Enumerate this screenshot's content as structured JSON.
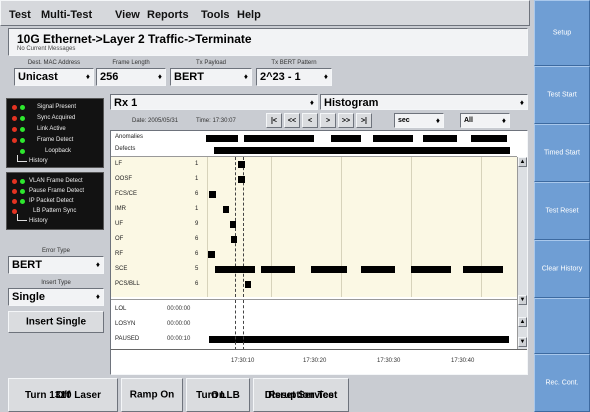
{
  "menu": [
    "Test",
    "Multi-Test",
    "View",
    "Reports",
    "Tools",
    "Help"
  ],
  "header": {
    "title": "10G Ethernet->Layer 2 Traffic->Terminate",
    "subtitle": "No Current Messages"
  },
  "selectors": [
    {
      "label": "Dest. MAC Address",
      "value": "Unicast"
    },
    {
      "label": "Frame Length",
      "value": "256"
    },
    {
      "label": "Tx Payload",
      "value": "BERT"
    },
    {
      "label": "Tx BERT Pattern",
      "value": "2^23 - 1"
    }
  ],
  "led_panel_1": {
    "items": [
      "Signal Present",
      "Sync Acquired",
      "Link Active",
      "Frame Detect",
      "Loopback"
    ],
    "history": "History"
  },
  "led_panel_2": {
    "items": [
      "VLAN Frame Detect",
      "Pause Frame Detect",
      "IP Packet Detect",
      "LB Pattern Sync"
    ],
    "history": "History"
  },
  "error_type": {
    "label": "Error Type",
    "value": "BERT"
  },
  "insert_type": {
    "label": "Insert Type",
    "value": "Single"
  },
  "insert_button": "Insert Single",
  "view": {
    "port": "Rx 1",
    "mode": "Histogram",
    "date_label": "Date: 2005/05/31",
    "time_label": "Time: 17:30:07",
    "nav": [
      "|<",
      "<<",
      "<",
      ">",
      ">>",
      ">|"
    ],
    "resolution": "sec",
    "filter": "All"
  },
  "histogram": {
    "summary_rows": [
      "Anomalies",
      "Defects"
    ],
    "rows": [
      {
        "label": "LF",
        "count": "1"
      },
      {
        "label": "OOSF",
        "count": "1"
      },
      {
        "label": "FCS/CE",
        "count": "6"
      },
      {
        "label": "IMR",
        "count": "1"
      },
      {
        "label": "UF",
        "count": "9"
      },
      {
        "label": "OF",
        "count": "6"
      },
      {
        "label": "RF",
        "count": "6"
      },
      {
        "label": "SCE",
        "count": "5"
      },
      {
        "label": "PCS/BLL",
        "count": "6"
      }
    ],
    "status_rows": [
      {
        "label": "LOL",
        "value": "00:00:00"
      },
      {
        "label": "LOSYN",
        "value": "00:00:00"
      },
      {
        "label": "PAUSED",
        "value": "00:00:10"
      }
    ],
    "time_ticks": [
      "17:30:10",
      "17:30:20",
      "17:30:30",
      "17:30:40"
    ]
  },
  "bottom_buttons": [
    {
      "line1": "Turn 1310 Laser",
      "line2": "Off"
    },
    {
      "line1": "Ramp On",
      "line2": ""
    },
    {
      "line1": "Turn LLB",
      "line2": "On"
    },
    {
      "line1": "Reset Service",
      "line2": "Disruption Test"
    }
  ],
  "softkeys": [
    "Setup",
    "Test Start",
    "Timed Start",
    "Test Reset",
    "Clear History",
    "",
    "Rec. Cont."
  ],
  "colors": {
    "softkey": "#6f9ed4",
    "led_green": "#2ee82e",
    "led_red": "#e53322",
    "bar": "#000000"
  }
}
